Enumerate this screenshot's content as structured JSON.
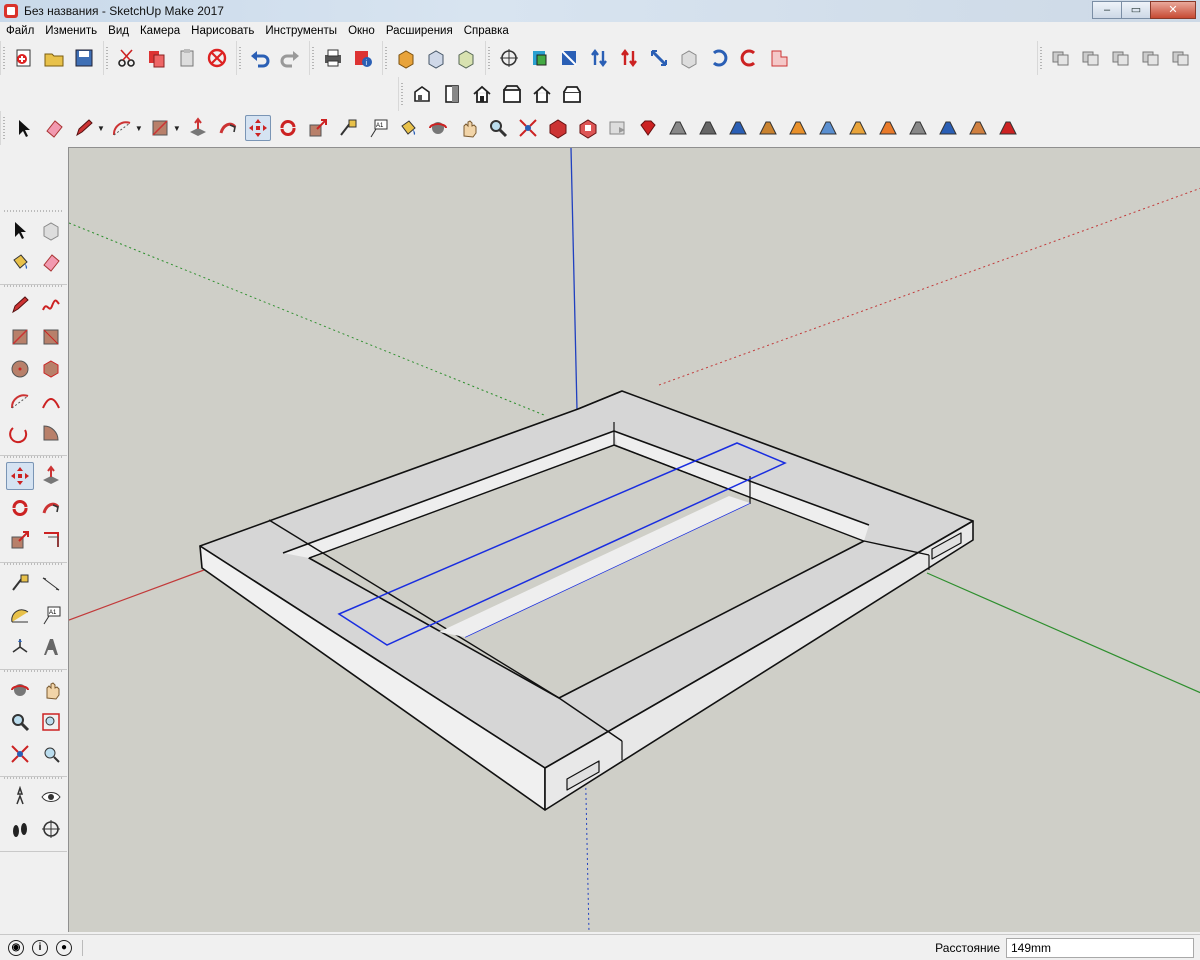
{
  "window": {
    "title": "Без названия - SketchUp Make 2017",
    "controls": {
      "minimize": "–",
      "maximize": "▭",
      "close": "✕"
    }
  },
  "menu": [
    "Файл",
    "Изменить",
    "Вид",
    "Камера",
    "Нарисовать",
    "Инструменты",
    "Окно",
    "Расширения",
    "Справка"
  ],
  "toolbar_top": {
    "file_tools": [
      "new-icon",
      "open-icon",
      "save-icon"
    ],
    "edit_tools": [
      "cut-icon",
      "copy-icon",
      "paste-icon",
      "erase-icon"
    ],
    "history_tools": [
      "undo-icon",
      "redo-icon"
    ],
    "print_tools": [
      "print-icon",
      "model-info-icon"
    ],
    "style_tools": [
      "xray-style-icon",
      "wireframe-style-icon",
      "hidden-line-style-icon"
    ],
    "section_tools": [
      "section-plane-icon",
      "section-display-icon",
      "section-cut-icon",
      "push-pull-up-icon",
      "push-pull-down-icon",
      "move-diag-icon",
      "component-icon",
      "rotate-left-icon",
      "rotate-right-icon",
      "flip-icon"
    ],
    "layer_tools": [
      "layer-1-icon",
      "layer-2-icon",
      "layer-3-icon",
      "layer-4-icon",
      "layer-5-icon"
    ]
  },
  "toolbar_views": [
    "iso-view-icon",
    "front-view-icon",
    "top-house-icon",
    "right-view-icon",
    "back-view-icon",
    "left-view-icon"
  ],
  "toolbar_main": {
    "tools": [
      "select-icon",
      "eraser-icon",
      "pencil-icon",
      "arc-icon",
      "rectangle-icon",
      "push-pull-icon",
      "follow-me-icon",
      "move-icon",
      "rotate-icon",
      "scale-icon",
      "tape-measure-icon",
      "text-icon",
      "paint-bucket-icon",
      "orbit-icon",
      "pan-icon",
      "zoom-icon",
      "zoom-extents-icon",
      "warehouse-icon",
      "extension-warehouse-icon",
      "share-icon",
      "ruby-icon",
      "sandbox-1-icon",
      "sandbox-2-icon",
      "sandbox-3-icon",
      "sandbox-4-icon",
      "sandbox-5-icon",
      "sandbox-6-icon",
      "sandbox-7-icon",
      "sandbox-8-icon",
      "sandbox-9-icon",
      "sandbox-10-icon",
      "sandbox-11-icon",
      "sandbox-12-icon"
    ],
    "active_tool": "move-icon"
  },
  "left_palette": [
    [
      [
        "select-icon",
        "component-icon"
      ],
      [
        "paint-bucket-icon",
        "eraser-icon"
      ]
    ],
    [
      [
        "pencil-icon",
        "freehand-icon"
      ],
      [
        "rectangle-icon",
        "rotated-rectangle-icon"
      ],
      [
        "circle-icon",
        "polygon-icon"
      ],
      [
        "arc-icon",
        "two-point-arc-icon"
      ],
      [
        "three-point-arc-icon",
        "pie-icon"
      ]
    ],
    [
      [
        "move-icon",
        "push-pull-icon"
      ],
      [
        "rotate-icon",
        "follow-me-icon"
      ],
      [
        "scale-icon",
        "offset-icon"
      ]
    ],
    [
      [
        "tape-measure-icon",
        "dimension-icon"
      ],
      [
        "protractor-icon",
        "text-icon"
      ],
      [
        "axes-icon",
        "3d-text-icon"
      ]
    ],
    [
      [
        "orbit-icon",
        "pan-icon"
      ],
      [
        "zoom-icon",
        "zoom-window-icon"
      ],
      [
        "zoom-extents-icon",
        "previous-view-icon"
      ]
    ],
    [
      [
        "position-camera-icon",
        "look-around-icon"
      ],
      [
        "walk-icon",
        "section-plane-icon"
      ]
    ]
  ],
  "viewport": {
    "background": "#cfcfc8",
    "axis_colors": {
      "red": "#c23a3a",
      "green": "#2e8f2e",
      "blue": "#2040c0"
    },
    "model_face_top": "#d6d6d6",
    "model_face_side": "#f0f0f0",
    "selection_color": "#1a2ee0"
  },
  "statusbar": {
    "icons": [
      "geo-location-icon",
      "credits-icon",
      "account-icon"
    ],
    "measurement_label": "Расстояние",
    "measurement_value": "149mm"
  }
}
